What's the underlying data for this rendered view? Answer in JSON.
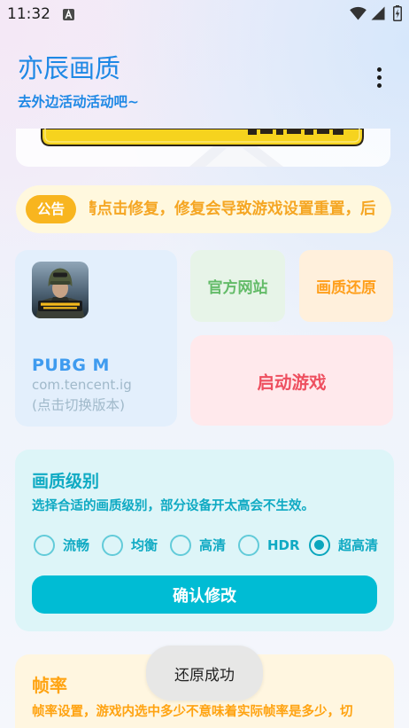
{
  "status_bar": {
    "time": "11:32",
    "icons": [
      "notification-a-icon",
      "wifi-icon",
      "signal-icon",
      "battery-charging-icon"
    ]
  },
  "header": {
    "title": "亦辰画质",
    "subtitle": "去外边活动活动吧~",
    "menu_icon": "more-vert-icon"
  },
  "banner": {
    "icon": "banner-image"
  },
  "announcement": {
    "badge": "公告",
    "text": "请点击修复，修复会导致游戏设置重置，后"
  },
  "game": {
    "icon": "pubg-app-icon",
    "name": "PUBG M",
    "package": "com.tencent.ig",
    "switch_hint": "(点击切换版本)"
  },
  "actions": {
    "website": "官方网站",
    "restore": "画质还原",
    "launch": "启动游戏"
  },
  "quality": {
    "title": "画质级别",
    "description": "选择合适的画质级别，部分设备开太高会不生效。",
    "options": [
      "流畅",
      "均衡",
      "高清",
      "HDR",
      "超高清"
    ],
    "selected": "超高清",
    "confirm_label": "确认修改"
  },
  "frame_rate": {
    "title": "帧率",
    "description": "帧率设置，游戏内选中多少不意味着实际帧率是多少，切"
  },
  "toast": {
    "message": "还原成功"
  },
  "colors": {
    "primary": "#1E88E5",
    "notice": "#F5A623",
    "badge": "#F8B51F",
    "game": "#3E9BEF",
    "website": "#63BB68",
    "restore": "#FF9F1C",
    "launch": "#EE4F5F",
    "quality": "#0FAAC3",
    "button": "#00BCD4",
    "frame": "#FFA311"
  }
}
